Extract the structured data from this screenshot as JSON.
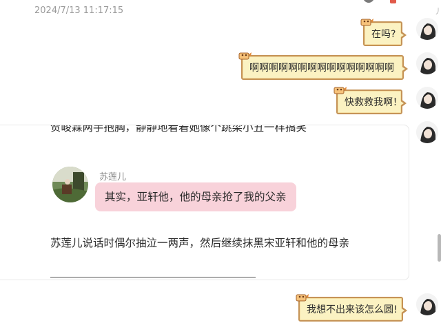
{
  "timestamp": "2024/7/13 11:17:15",
  "corner_text": "丿",
  "messages": [
    {
      "text": "在吗?"
    },
    {
      "text": "啊啊啊啊啊啊啊啊啊啊啊啊啊啊啊"
    },
    {
      "text": "快救救我啊！"
    }
  ],
  "story": {
    "partial_line": "贺峻霖两手抱胸，静静地看着她像个跳梁小丑一样搞笑",
    "speaker_name": "苏莲儿",
    "speaker_quote": "其实，亚轩他，他的母亲抢了我的父亲",
    "narration": "苏莲儿说话时偶尔抽泣一两声，然后继续抹黑宋亚轩和他的母亲"
  },
  "last_message": {
    "text": "我想不出来该怎么圆!"
  },
  "colors": {
    "bubble_fill": "#fbf2c2",
    "bubble_border": "#c59356",
    "quote_bubble": "#f8d2da",
    "timestamp": "#9a9a9a"
  }
}
